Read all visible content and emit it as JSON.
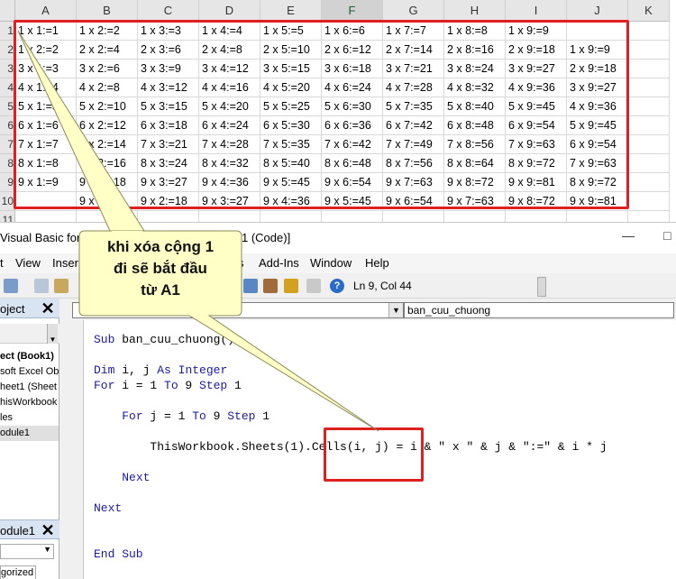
{
  "sheet": {
    "columns": [
      "A",
      "B",
      "C",
      "D",
      "E",
      "F",
      "G",
      "H",
      "I",
      "J",
      "K"
    ],
    "selected_column": "F",
    "rows": [
      {
        "num": "1",
        "cells": [
          "1 x 1:=1",
          "1 x 2:=2",
          "1 x 3:=3",
          "1 x 4:=4",
          "1 x 5:=5",
          "1 x 6:=6",
          "1 x 7:=7",
          "1 x 8:=8",
          "1 x 9:=9",
          "",
          ""
        ]
      },
      {
        "num": "2",
        "cells": [
          "1 x 2:=2",
          "2 x 2:=4",
          "2 x 3:=6",
          "2 x 4:=8",
          "2 x 5:=10",
          "2 x 6:=12",
          "2 x 7:=14",
          "2 x 8:=16",
          "2 x 9:=18",
          "1 x 9:=9",
          ""
        ]
      },
      {
        "num": "3",
        "cells": [
          "3 x 1:=3",
          "3 x 2:=6",
          "3 x 3:=9",
          "3 x 4:=12",
          "3 x 5:=15",
          "3 x 6:=18",
          "3 x 7:=21",
          "3 x 8:=24",
          "3 x 9:=27",
          "2 x 9:=18",
          ""
        ]
      },
      {
        "num": "4",
        "cells": [
          "4 x 1:=4",
          "4 x 2:=8",
          "4 x 3:=12",
          "4 x 4:=16",
          "4 x 5:=20",
          "4 x 6:=24",
          "4 x 7:=28",
          "4 x 8:=32",
          "4 x 9:=36",
          "3 x 9:=27",
          ""
        ]
      },
      {
        "num": "5",
        "cells": [
          "5 x 1:=5",
          "5 x 2:=10",
          "5 x 3:=15",
          "5 x 4:=20",
          "5 x 5:=25",
          "5 x 6:=30",
          "5 x 7:=35",
          "5 x 8:=40",
          "5 x 9:=45",
          "4 x 9:=36",
          ""
        ]
      },
      {
        "num": "6",
        "cells": [
          "6 x 1:=6",
          "6 x 2:=12",
          "6 x 3:=18",
          "6 x 4:=24",
          "6 x 5:=30",
          "6 x 6:=36",
          "6 x 7:=42",
          "6 x 8:=48",
          "6 x 9:=54",
          "5 x 9:=45",
          ""
        ]
      },
      {
        "num": "7",
        "cells": [
          "7 x 1:=7",
          "7 x 2:=14",
          "7 x 3:=21",
          "7 x 4:=28",
          "7 x 5:=35",
          "7 x 6:=42",
          "7 x 7:=49",
          "7 x 8:=56",
          "7 x 9:=63",
          "6 x 9:=54",
          ""
        ]
      },
      {
        "num": "8",
        "cells": [
          "8 x 1:=8",
          "8 x 2:=16",
          "8 x 3:=24",
          "8 x 4:=32",
          "8 x 5:=40",
          "8 x 6:=48",
          "8 x 7:=56",
          "8 x 8:=64",
          "8 x 9:=72",
          "7 x 9:=63",
          ""
        ]
      },
      {
        "num": "9",
        "cells": [
          "9 x 1:=9",
          "9 x 2:=18",
          "9 x 3:=27",
          "9 x 4:=36",
          "9 x 5:=45",
          "9 x 6:=54",
          "9 x 7:=63",
          "9 x 8:=72",
          "9 x 9:=81",
          "8 x 9:=72",
          ""
        ]
      },
      {
        "num": "10",
        "cells": [
          "",
          "9 x 1:=9",
          "9 x 2:=18",
          "9 x 3:=27",
          "9 x 4:=36",
          "9 x 5:=45",
          "9 x 6:=54",
          "9 x 7:=63",
          "9 x 8:=72",
          "9 x 9:=81",
          ""
        ]
      },
      {
        "num": "11",
        "cells": [
          "",
          "",
          "",
          "",
          "",
          "",
          "",
          "",
          "",
          "",
          ""
        ]
      }
    ]
  },
  "vba": {
    "title_left": "Visual Basic for",
    "title_right": "1 (Code)]",
    "menu": [
      "t",
      "View",
      "Inser",
      "s",
      "Add-Ins",
      "Window",
      "Help"
    ],
    "status": "Ln 9, Col 44",
    "project_title": "oject",
    "tree": [
      "ect (Book1)",
      "soft Excel Ob",
      "heet1 (Sheet",
      "hisWorkbook",
      "les",
      "odule1"
    ],
    "module_title": "odule1",
    "props_tab": "gorized",
    "proc_combo": "ban_cuu_chuong",
    "code": [
      "Sub ban_cuu_chuong()",
      "",
      "Dim i, j As Integer",
      "For i = 1 To 9 Step 1",
      "",
      "    For j = 1 To 9 Step 1",
      "",
      "        ThisWorkbook.Sheets(1).Cells(i, j) = i & \" x \" & j & \":=\" & i * j",
      "",
      "    Next",
      "",
      "Next",
      "",
      "",
      "End Sub"
    ]
  },
  "callout": {
    "line1": "khi xóa cộng 1",
    "line2": "đi sẽ bắt đầu",
    "line3": "từ A1"
  },
  "colors": {
    "highlight_red": "#e02020",
    "callout_fill": "#ffffc6",
    "keyword_blue": "#1a1aa6"
  }
}
